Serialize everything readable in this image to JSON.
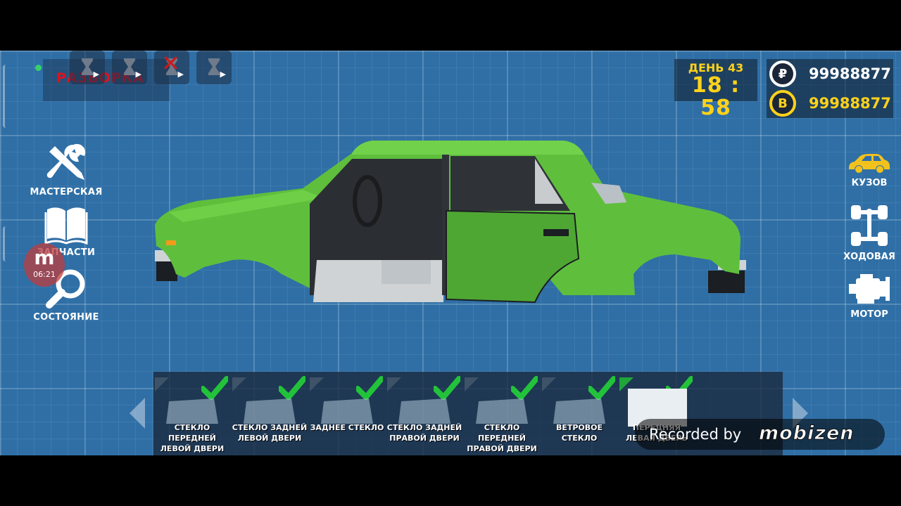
{
  "top_bar": {
    "brand": "РАЗБОРКА",
    "ad_slots": [
      {
        "icon": "hourglass-icon",
        "disabled": false
      },
      {
        "icon": "hourglass-icon",
        "disabled": false
      },
      {
        "icon": "hourglass-icon",
        "disabled": true
      },
      {
        "icon": "hourglass-icon",
        "disabled": false
      }
    ]
  },
  "clock": {
    "day": "ДЕНЬ 43",
    "time": "18 : 58"
  },
  "money": {
    "rubles": "99988877",
    "bitcoin": "99988877",
    "rub_symbol": "₽",
    "btc_symbol": "B"
  },
  "left_menu": {
    "workshop": "МАСТЕРСКАЯ",
    "parts": "ЗАПЧАСТИ",
    "condition": "СОСТОЯНИЕ"
  },
  "recorder_badge": {
    "letter": "m",
    "time": "06:21"
  },
  "right_menu": {
    "body": "КУЗОВ",
    "chassis": "ХОДОВАЯ",
    "engine": "МОТОР"
  },
  "parts": [
    {
      "line1": "СТЕКЛО ПЕРЕДНЕЙ",
      "line2": "ЛЕВОЙ ДВЕРИ",
      "installed": true
    },
    {
      "line1": "СТЕКЛО ЗАДНЕЙ",
      "line2": "ЛЕВОЙ ДВЕРИ",
      "installed": true
    },
    {
      "line1": "ЗАДНЕЕ СТЕКЛО",
      "line2": "",
      "installed": true
    },
    {
      "line1": "СТЕКЛО ЗАДНЕЙ",
      "line2": "ПРАВОЙ ДВЕРИ",
      "installed": true
    },
    {
      "line1": "СТЕКЛО ПЕРЕДНЕЙ",
      "line2": "ПРАВОЙ ДВЕРИ",
      "installed": true
    },
    {
      "line1": "ВЕТРОВОЕ",
      "line2": "СТЕКЛО",
      "installed": true
    },
    {
      "line1": "ПЕРЕДНЯЯ",
      "line2": "ЛЕВАЯ ДВЕРЬ",
      "installed": true
    }
  ],
  "watermark": {
    "prefix": "Recorded by",
    "logo": "mobizen"
  },
  "colors": {
    "car_body": "#5fbf3c",
    "accent_yellow": "#ffd21a",
    "check_green": "#22c33a"
  }
}
